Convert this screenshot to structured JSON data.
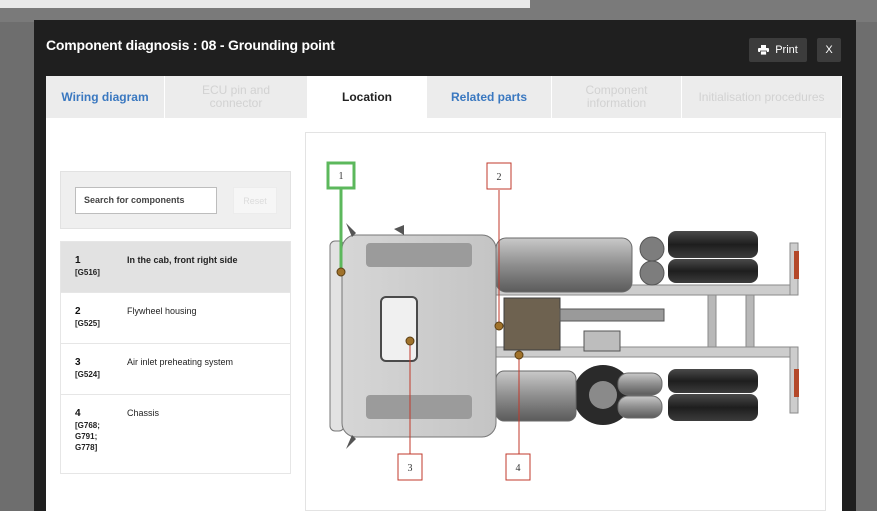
{
  "modal": {
    "title": "Component diagnosis : 08 - Grounding point",
    "print_label": "Print",
    "close_label": "X"
  },
  "tabs": [
    {
      "label": "Wiring diagram",
      "state": "enabled"
    },
    {
      "label": "ECU pin and connector",
      "state": "disabled"
    },
    {
      "label": "Location",
      "state": "active"
    },
    {
      "label": "Related parts",
      "state": "enabled"
    },
    {
      "label": "Component information",
      "state": "disabled"
    },
    {
      "label": "Initialisation procedures",
      "state": "disabled"
    }
  ],
  "search": {
    "placeholder": "Search for components",
    "reset_label": "Reset"
  },
  "components": [
    {
      "number": "1",
      "codes": "[G516]",
      "description": "In the cab, front right side",
      "selected": true
    },
    {
      "number": "2",
      "codes": "[G525]",
      "description": "Flywheel housing",
      "selected": false
    },
    {
      "number": "3",
      "codes": "[G524]",
      "description": "Air inlet preheating system",
      "selected": false
    },
    {
      "number": "4",
      "codes": "[G768; G791; G778]",
      "description": "Chassis",
      "selected": false
    }
  ],
  "diagram": {
    "callouts": [
      "1",
      "2",
      "3",
      "4"
    ],
    "highlight_color": "#5cb85c",
    "callout_color": "#c0392b",
    "marker_color": "#a0722b"
  }
}
